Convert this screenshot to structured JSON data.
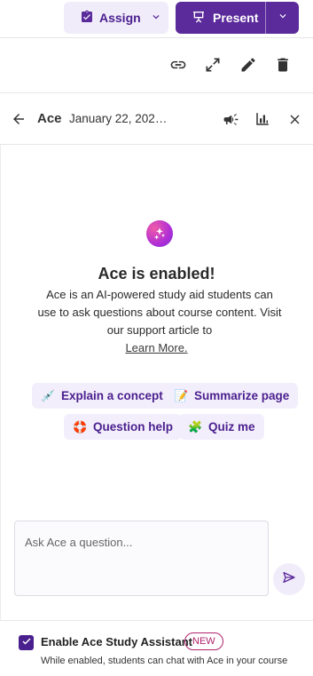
{
  "toolbar": {
    "assign_label": "Assign",
    "present_label": "Present",
    "icons": [
      "clipboard-check-icon",
      "chevron-down-icon",
      "present-icon",
      "link-icon",
      "expand-icon",
      "pencil-icon",
      "trash-icon"
    ]
  },
  "panel": {
    "title": "Ace",
    "date": "January 22, 202…",
    "header_icons": [
      "back-arrow-icon",
      "megaphone-icon",
      "bar-chart-icon",
      "close-icon"
    ]
  },
  "intro": {
    "heading": "Ace is enabled!",
    "description": "Ace is an AI-powered study aid students can use to ask questions about course content. Visit our support article to",
    "link": "Learn More."
  },
  "suggestions": [
    {
      "emoji": "💉",
      "label": "Explain a concept"
    },
    {
      "emoji": "📝",
      "label": "Summarize page"
    },
    {
      "emoji": "🛟",
      "label": "Question help"
    },
    {
      "emoji": "🧩",
      "label": "Quiz me"
    }
  ],
  "ask": {
    "placeholder": "Ask Ace a question..."
  },
  "footer": {
    "label": "Enable Ace Study Assistant",
    "badge": "NEW",
    "subtext": "While enabled, students can chat with Ace in your course",
    "checked": true
  },
  "colors": {
    "accent": "#5b2a9b",
    "accent_dark": "#4a1f8e",
    "chip_bg": "#f3eefb",
    "badge": "#b0226c"
  }
}
